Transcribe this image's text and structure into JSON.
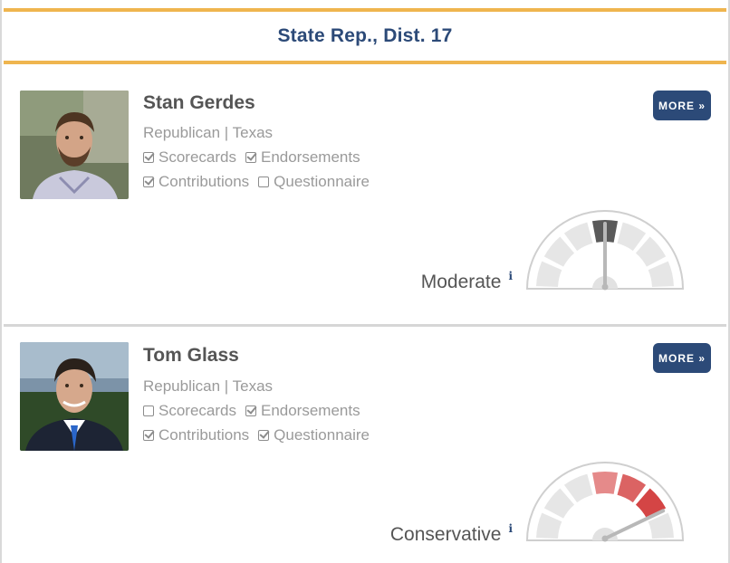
{
  "race": {
    "title": "State Rep., Dist. 17"
  },
  "candidates": [
    {
      "name": "Stan Gerdes",
      "party_state": "Republican | Texas",
      "checks": [
        {
          "label": "Scorecards",
          "checked": true
        },
        {
          "label": "Endorsements",
          "checked": true
        },
        {
          "label": "Contributions",
          "checked": true
        },
        {
          "label": "Questionnaire",
          "checked": false
        }
      ],
      "more_label": "MORE »",
      "rating": "Moderate",
      "info_glyph": "i",
      "gauge_level": 0.5,
      "gauge_highlight": [
        4
      ]
    },
    {
      "name": "Tom Glass",
      "party_state": "Republican | Texas",
      "checks": [
        {
          "label": "Scorecards",
          "checked": false
        },
        {
          "label": "Endorsements",
          "checked": true
        },
        {
          "label": "Contributions",
          "checked": true
        },
        {
          "label": "Questionnaire",
          "checked": true
        }
      ],
      "more_label": "MORE »",
      "rating": "Conservative",
      "info_glyph": "i",
      "gauge_level": 0.85,
      "gauge_highlight": [
        4,
        5,
        6
      ]
    }
  ],
  "colors": {
    "header_text": "#2c4a78",
    "header_rule": "#efb54f",
    "button_bg": "#2c4a78",
    "gauge_segment": "#e6e6e6",
    "gauge_moderate": "#5a5a5a",
    "gauge_conservative": [
      "#e58a8a",
      "#db6363",
      "#d44545"
    ],
    "needle": "#b8b8b8"
  }
}
